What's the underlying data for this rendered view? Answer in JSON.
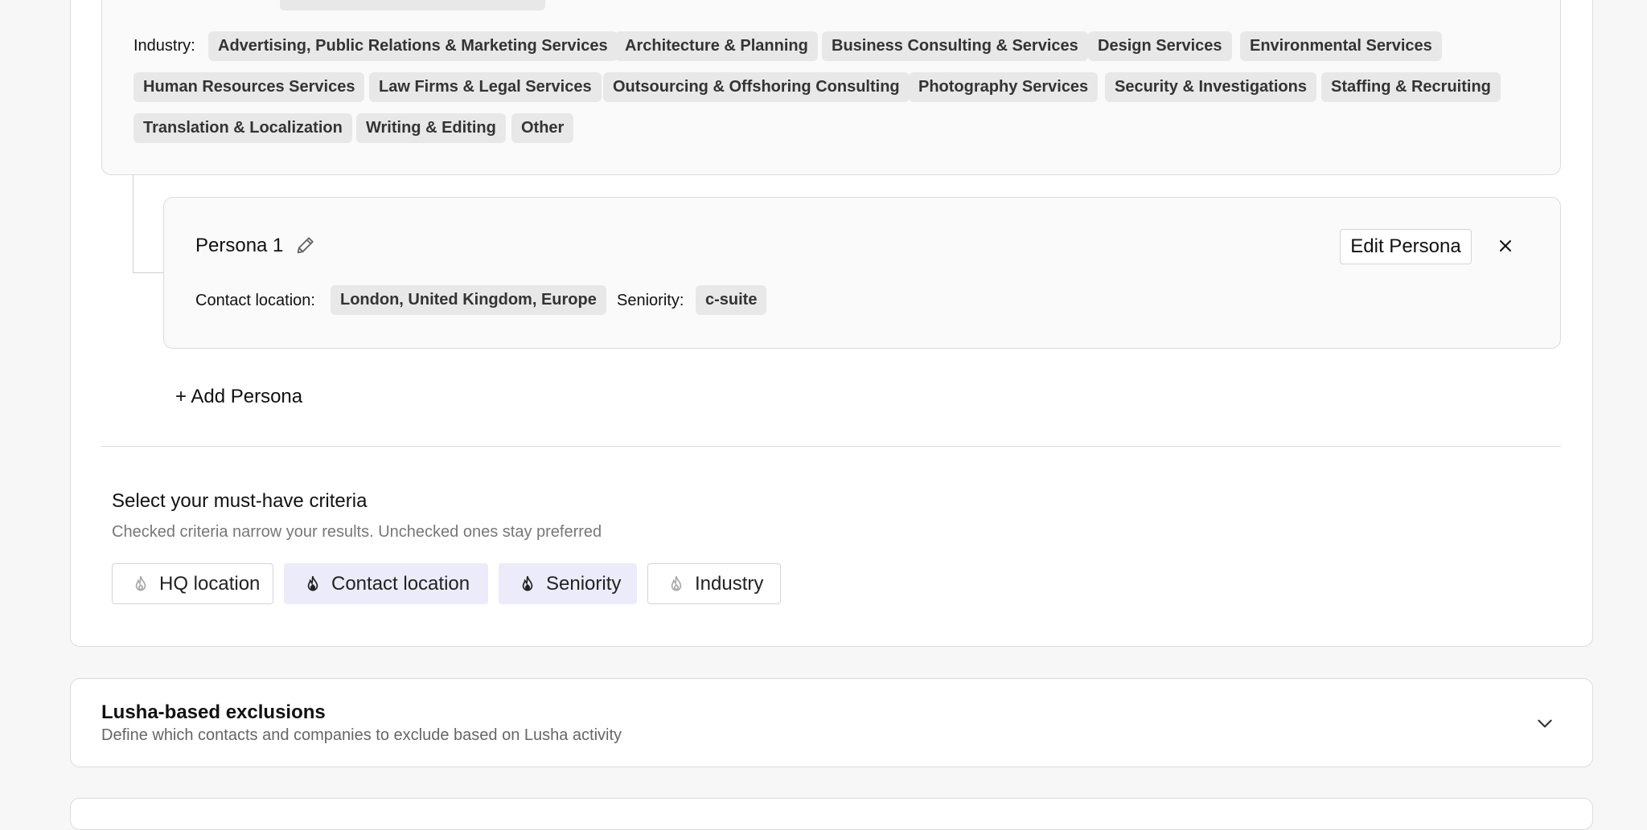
{
  "company": {
    "industry_label": "Industry:",
    "industries": [
      "Advertising, Public Relations & Marketing Services",
      "Architecture & Planning",
      "Business Consulting & Services",
      "Design Services",
      "Environmental Services",
      "Human Resources Services",
      "Law Firms & Legal Services",
      "Outsourcing & Offshoring Consulting",
      "Photography Services",
      "Security & Investigations",
      "Staffing & Recruiting",
      "Translation & Localization",
      "Writing & Editing",
      "Other"
    ]
  },
  "persona": {
    "title": "Persona 1",
    "edit_label": "Edit Persona",
    "contact_location_label": "Contact location:",
    "contact_location_value": "London, United Kingdom, Europe",
    "seniority_label": "Seniority:",
    "seniority_value": "c-suite",
    "icons": {
      "edit": "pencil-icon",
      "remove": "close-icon"
    }
  },
  "add_persona_label": "+ Add Persona",
  "criteria": {
    "title": "Select your must-have criteria",
    "subtitle": "Checked criteria narrow your results. Unchecked ones stay preferred",
    "items": [
      {
        "label": "HQ location",
        "checked": false
      },
      {
        "label": "Contact location",
        "checked": true
      },
      {
        "label": "Seniority",
        "checked": true
      },
      {
        "label": "Industry",
        "checked": false
      }
    ],
    "icon": "flame-icon"
  },
  "exclusions": {
    "title": "Lusha-based exclusions",
    "subtitle": "Define which contacts and companies to exclude based on Lusha activity",
    "icon": "chevron-down-icon"
  },
  "colors": {
    "selected_criteria_bg": "#ecebfa",
    "tag_bg": "#e8e8e8",
    "border": "#dcdcdc"
  }
}
